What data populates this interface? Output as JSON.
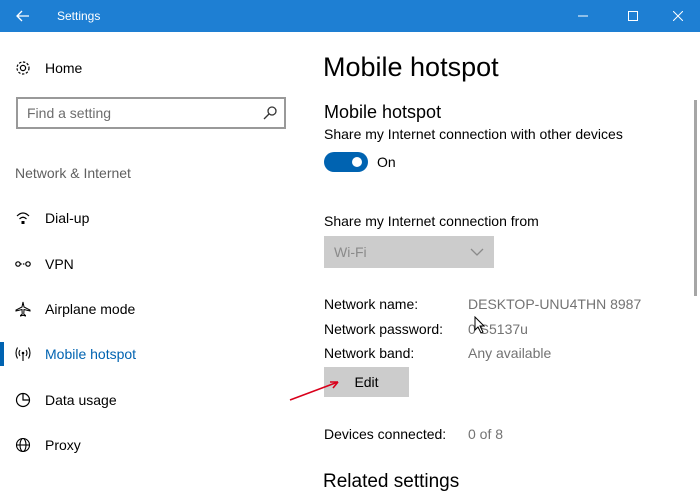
{
  "window": {
    "title": "Settings",
    "accent": "#1e7fd3",
    "controls": [
      "minimize",
      "maximize",
      "close"
    ]
  },
  "sidebar": {
    "home_label": "Home",
    "search_placeholder": "Find a setting",
    "section_label": "Network & Internet",
    "items": [
      {
        "label": "Dial-up",
        "icon": "dial-up-icon"
      },
      {
        "label": "VPN",
        "icon": "vpn-icon"
      },
      {
        "label": "Airplane mode",
        "icon": "airplane-icon"
      },
      {
        "label": "Mobile hotspot",
        "icon": "hotspot-icon",
        "active": true
      },
      {
        "label": "Data usage",
        "icon": "data-usage-icon"
      },
      {
        "label": "Proxy",
        "icon": "globe-icon"
      }
    ]
  },
  "main": {
    "page_title": "Mobile hotspot",
    "section_title": "Mobile hotspot",
    "share_description": "Share my Internet connection with other devices",
    "toggle_state": "On",
    "share_from_label": "Share my Internet connection from",
    "share_from_value": "Wi-Fi",
    "network_name_label": "Network name:",
    "network_name_value": "DESKTOP-UNU4THN 8987",
    "network_password_label": "Network password:",
    "network_password_value": "0  S5137u",
    "network_band_label": "Network band:",
    "network_band_value": "Any available",
    "edit_label": "Edit",
    "devices_connected_label": "Devices connected:",
    "devices_connected_value": "0 of 8",
    "related_settings_title": "Related settings"
  },
  "colors": {
    "active": "#0063b1",
    "annotation_arrow": "#d9001b"
  }
}
